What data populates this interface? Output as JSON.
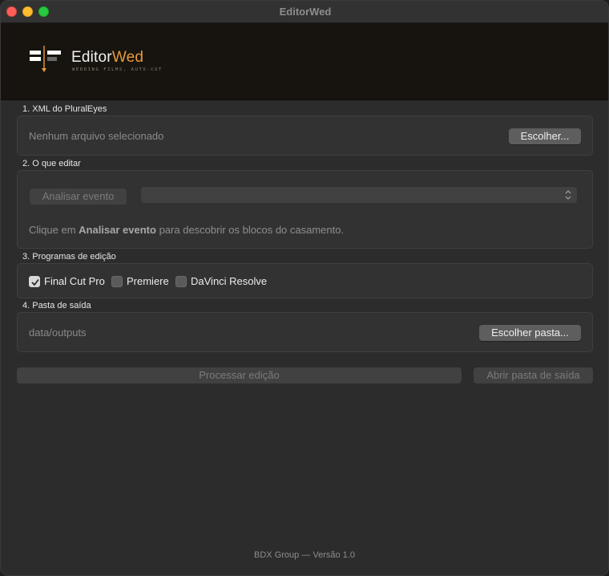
{
  "window": {
    "title": "EditorWed"
  },
  "brand": {
    "name_part1": "Editor",
    "name_part2": "Wed",
    "tagline": "WEDDING FILMS, AUTO-CUT",
    "accent_color": "#e89a3a"
  },
  "sections": {
    "xml": {
      "label": "1. XML do PluralEyes",
      "file_status": "Nenhum arquivo selecionado",
      "choose_button": "Escolher..."
    },
    "edit": {
      "label": "2. O que editar",
      "analyze_button": "Analisar evento",
      "select_value": "",
      "hint_prefix": "Clique em ",
      "hint_bold": "Analisar evento",
      "hint_suffix": " para descobrir os blocos do casamento."
    },
    "programs": {
      "label": "3. Programas de edição",
      "options": [
        {
          "label": "Final Cut Pro",
          "checked": true
        },
        {
          "label": "Premiere",
          "checked": false
        },
        {
          "label": "DaVinci Resolve",
          "checked": false
        }
      ]
    },
    "output": {
      "label": "4. Pasta de saída",
      "path": "data/outputs",
      "choose_button": "Escolher pasta..."
    }
  },
  "actions": {
    "process_button": "Processar edição",
    "open_folder_button": "Abrir pasta de saída"
  },
  "footer": {
    "text": "BDX Group — Versão 1.0"
  }
}
